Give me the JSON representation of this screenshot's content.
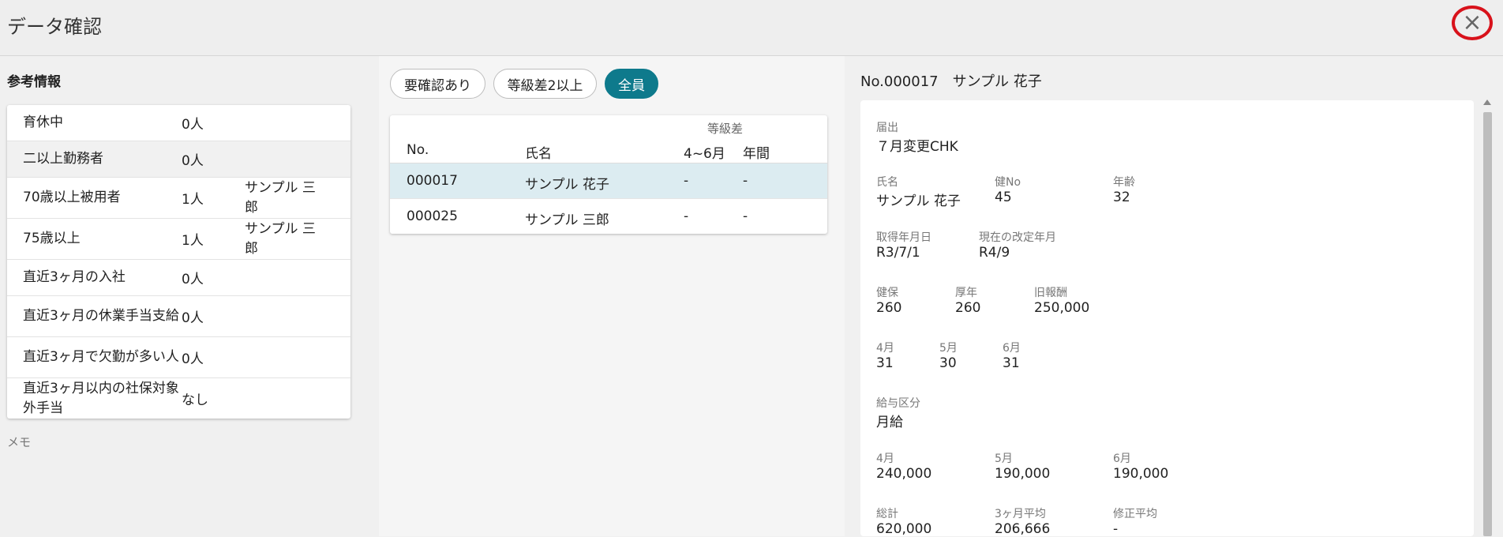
{
  "header": {
    "title": "データ確認",
    "close_icon": "×"
  },
  "reference": {
    "title": "参考情報",
    "rows": [
      {
        "label": "育休中",
        "value": "0人",
        "extra": ""
      },
      {
        "label": "二以上勤務者",
        "value": "0人",
        "extra": ""
      },
      {
        "label": "70歳以上被用者",
        "value": "1人",
        "extra": "サンプル 三郎"
      },
      {
        "label": "75歳以上",
        "value": "1人",
        "extra": "サンプル 三郎"
      },
      {
        "label": "直近3ヶ月の入社",
        "value": "0人",
        "extra": ""
      },
      {
        "label": "直近3ヶ月の休業手当支給",
        "value": "0人",
        "extra": ""
      },
      {
        "label": "直近3ヶ月で欠勤が多い人",
        "value": "0人",
        "extra": ""
      },
      {
        "label": "直近3ヶ月以内の社保対象外手当",
        "value": "なし",
        "extra": ""
      }
    ],
    "memo_label": "メモ"
  },
  "filters": {
    "needs_check": "要確認あり",
    "grade_diff": "等級差2以上",
    "all": "全員"
  },
  "list": {
    "grade_diff_header": "等級差",
    "col_no": "No.",
    "col_name": "氏名",
    "col_apr_jun": "4~6月",
    "col_annual": "年間",
    "rows": [
      {
        "no": "000017",
        "name": "サンプル 花子",
        "apr_jun": "-",
        "annual": "-"
      },
      {
        "no": "000025",
        "name": "サンプル 三郎",
        "apr_jun": "-",
        "annual": "-"
      }
    ]
  },
  "detail": {
    "header": "No.000017　サンプル 花子",
    "notice_label": "届出",
    "notice_value": "７月変更CHK",
    "name_label": "氏名",
    "name_value": "サンプル 花子",
    "kenno_label": "健No",
    "kenno_value": "45",
    "age_label": "年齢",
    "age_value": "32",
    "acquired_label": "取得年月日",
    "acquired_value": "R3/7/1",
    "revision_label": "現在の改定年月",
    "revision_value": "R4/9",
    "kenpo_label": "健保",
    "kenpo_value": "260",
    "kounen_label": "厚年",
    "kounen_value": "260",
    "old_pay_label": "旧報酬",
    "old_pay_value": "250,000",
    "days": [
      {
        "label": "4月",
        "value": "31"
      },
      {
        "label": "5月",
        "value": "30"
      },
      {
        "label": "6月",
        "value": "31"
      }
    ],
    "salary_type_label": "給与区分",
    "salary_type_value": "月給",
    "pay": [
      {
        "label": "4月",
        "value": "240,000"
      },
      {
        "label": "5月",
        "value": "190,000"
      },
      {
        "label": "6月",
        "value": "190,000"
      }
    ],
    "total_label": "総計",
    "total_value": "620,000",
    "avg_label": "3ヶ月平均",
    "avg_value": "206,666",
    "adj_label": "修正平均",
    "adj_value": "-"
  }
}
